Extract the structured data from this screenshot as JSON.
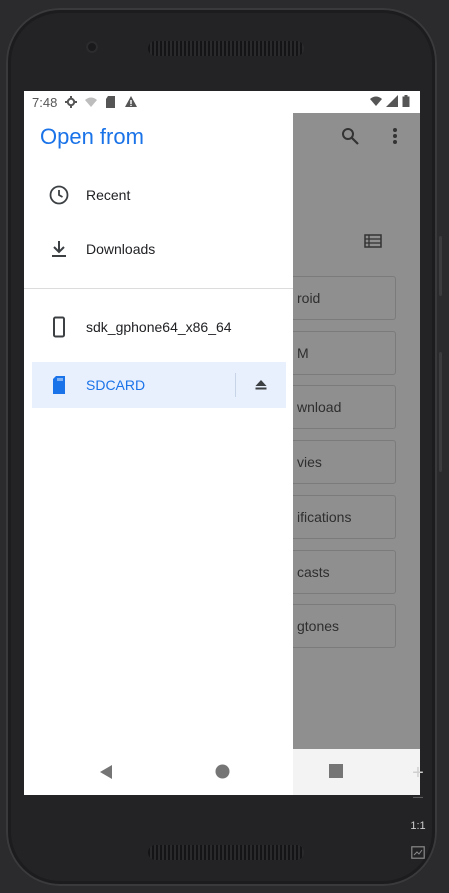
{
  "status_bar": {
    "time": "7:48"
  },
  "drawer": {
    "title": "Open from",
    "items": [
      {
        "label": "Recent",
        "icon": "clock-icon"
      },
      {
        "label": "Downloads",
        "icon": "download-icon"
      },
      {
        "label": "sdk_gphone64_x86_64",
        "icon": "phone-icon"
      },
      {
        "label": "SDCARD",
        "icon": "sd-card-icon",
        "selected": true,
        "action_icon": "eject-icon"
      }
    ]
  },
  "background_folders": [
    "roid",
    "M",
    "wnload",
    "vies",
    "ifications",
    "casts",
    "gtones"
  ],
  "emulator_tools": {
    "zoom_in": "+",
    "zoom_out": "—",
    "one_to_one": "1:1"
  },
  "colors": {
    "accent": "#1a73e8",
    "selected_bg": "#e8f0fe",
    "scrim": "#8f8f8f"
  }
}
